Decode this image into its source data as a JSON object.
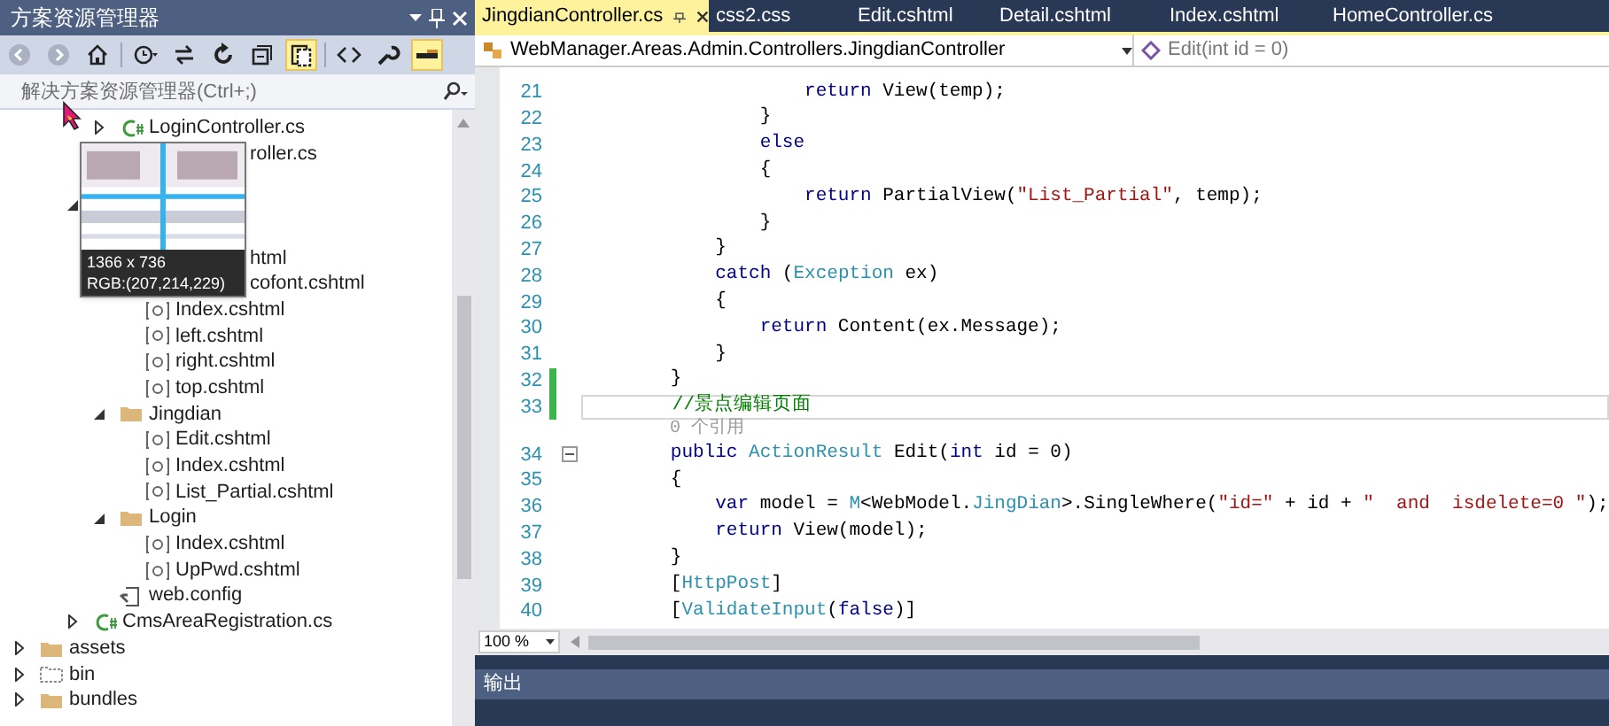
{
  "solution_explorer": {
    "title": "方案资源管理器",
    "title_buttons": [
      {
        "kind": "dropdown"
      },
      {
        "kind": "pin"
      },
      {
        "kind": "close"
      }
    ],
    "toolbar": [
      {
        "kind": "back",
        "active": false
      },
      {
        "kind": "forward",
        "active": false
      },
      {
        "kind": "home",
        "active": false
      },
      {
        "kind": "history",
        "active": false
      },
      {
        "kind": "sync",
        "active": false
      },
      {
        "kind": "refresh",
        "active": false
      },
      {
        "kind": "collapse",
        "active": false
      },
      {
        "kind": "show_all",
        "active": true
      },
      {
        "kind": "code",
        "active": false
      },
      {
        "kind": "wrench",
        "active": false
      },
      {
        "kind": "preview",
        "active": true
      }
    ],
    "search": {
      "placeholder": "解决方案资源管理器(Ctrl+;)"
    },
    "tree": [
      {
        "children": [
          {
            "children": [
              {
                "children": [
                  {
                    "kind": "cs",
                    "label": "LoginController.cs",
                    "expanded": false
                  },
                  {
                    "kind": "fragment",
                    "label": "roller.cs"
                  }
                ]
              },
              {
                "kind": "hidden"
              },
              {
                "kind": "hidden",
                "expanded": true,
                "children": [
                  {
                    "kind": "hidden",
                    "children": [
                      {
                        "kind": "fragment",
                        "label": "html"
                      },
                      {
                        "kind": "fragment",
                        "label": "cofont.cshtml"
                      },
                      {
                        "kind": "cshtml",
                        "label": "Index.cshtml"
                      },
                      {
                        "kind": "cshtml",
                        "label": "left.cshtml"
                      },
                      {
                        "kind": "cshtml",
                        "label": "right.cshtml"
                      },
                      {
                        "kind": "cshtml",
                        "label": "top.cshtml"
                      }
                    ]
                  },
                  {
                    "kind": "folder",
                    "label": "Jingdian",
                    "expanded": true,
                    "children": [
                      {
                        "kind": "cshtml",
                        "label": "Edit.cshtml"
                      },
                      {
                        "kind": "cshtml",
                        "label": "Index.cshtml"
                      },
                      {
                        "kind": "cshtml",
                        "label": "List_Partial.cshtml"
                      }
                    ]
                  },
                  {
                    "kind": "folder",
                    "label": "Login",
                    "expanded": true,
                    "children": [
                      {
                        "kind": "cshtml",
                        "label": "Index.cshtml"
                      },
                      {
                        "kind": "cshtml",
                        "label": "UpPwd.cshtml"
                      }
                    ]
                  },
                  {
                    "kind": "config",
                    "label": "web.config"
                  }
                ]
              },
              {
                "kind": "cs",
                "label": "CmsAreaRegistration.cs",
                "expanded": false
              }
            ]
          }
        ]
      },
      {
        "kind": "folder",
        "label": "assets",
        "expanded": false
      },
      {
        "kind": "dashed_folder",
        "label": "bin",
        "expanded": false
      },
      {
        "kind": "folder",
        "label": "bundles",
        "expanded": false
      }
    ]
  },
  "magnifier": {
    "size": "1366 x 736",
    "rgb_reading": "RGB:(207,214,229)"
  },
  "editor": {
    "tabs": [
      {
        "label": "JingdianController.cs",
        "selected": true
      },
      {
        "label": "css2.css",
        "selected": false
      },
      {
        "label": "Edit.cshtml",
        "selected": false
      },
      {
        "label": "Detail.cshtml",
        "selected": false
      },
      {
        "label": "Index.cshtml",
        "selected": false
      },
      {
        "label": "HomeController.cs",
        "selected": false
      }
    ],
    "class_dropdown": "WebManager.Areas.Admin.Controllers.JingdianController",
    "member_dropdown": "Edit(int id = 0)",
    "lines": [
      {
        "kind": "code",
        "number": "21",
        "tokens": [
          {
            "kind": "keyword",
            "text": "                    return"
          },
          {
            "kind": "plain",
            "text": " View(temp);"
          }
        ]
      },
      {
        "kind": "code",
        "number": "22",
        "tokens": [
          {
            "kind": "plain",
            "text": "                }"
          }
        ]
      },
      {
        "kind": "code",
        "number": "23",
        "tokens": [
          {
            "kind": "keyword",
            "text": "                else"
          }
        ]
      },
      {
        "kind": "code",
        "number": "24",
        "tokens": [
          {
            "kind": "plain",
            "text": "                {"
          }
        ]
      },
      {
        "kind": "code",
        "number": "25",
        "tokens": [
          {
            "kind": "keyword",
            "text": "                    return"
          },
          {
            "kind": "plain",
            "text": " PartialView("
          },
          {
            "kind": "string",
            "text": "\"List_Partial\""
          },
          {
            "kind": "plain",
            "text": ", temp);"
          }
        ]
      },
      {
        "kind": "code",
        "number": "26",
        "tokens": [
          {
            "kind": "plain",
            "text": "                }"
          }
        ]
      },
      {
        "kind": "code",
        "number": "27",
        "tokens": [
          {
            "kind": "plain",
            "text": "            }"
          }
        ]
      },
      {
        "kind": "code",
        "number": "28",
        "tokens": [
          {
            "kind": "keyword",
            "text": "            catch"
          },
          {
            "kind": "plain",
            "text": " ("
          },
          {
            "kind": "type",
            "text": "Exception"
          },
          {
            "kind": "plain",
            "text": " ex)"
          }
        ]
      },
      {
        "kind": "code",
        "number": "29",
        "tokens": [
          {
            "kind": "plain",
            "text": "            {"
          }
        ]
      },
      {
        "kind": "code",
        "number": "30",
        "tokens": [
          {
            "kind": "keyword",
            "text": "                return"
          },
          {
            "kind": "plain",
            "text": " Content(ex.Message);"
          }
        ]
      },
      {
        "kind": "code",
        "number": "31",
        "tokens": [
          {
            "kind": "plain",
            "text": "            }"
          }
        ]
      },
      {
        "kind": "code",
        "number": "32",
        "changed": true,
        "tokens": [
          {
            "kind": "plain",
            "text": "        }"
          }
        ]
      },
      {
        "kind": "code",
        "number": "33",
        "changed": true,
        "current": true,
        "tokens": [
          {
            "kind": "comment",
            "text": "        //景点编辑页面"
          }
        ]
      },
      {
        "kind": "lens",
        "text": "0 个引用"
      },
      {
        "kind": "code",
        "number": "34",
        "foldable": true,
        "tokens": [
          {
            "kind": "keyword",
            "text": "        public"
          },
          {
            "kind": "type",
            "text": " ActionResult"
          },
          {
            "kind": "plain",
            "text": " Edit("
          },
          {
            "kind": "keyword",
            "text": "int"
          },
          {
            "kind": "plain",
            "text": " id = 0)"
          }
        ]
      },
      {
        "kind": "code",
        "number": "35",
        "tokens": [
          {
            "kind": "plain",
            "text": "        {"
          }
        ]
      },
      {
        "kind": "code",
        "number": "36",
        "tokens": [
          {
            "kind": "keyword",
            "text": "            var"
          },
          {
            "kind": "plain",
            "text": " model = "
          },
          {
            "kind": "type",
            "text": "M"
          },
          {
            "kind": "plain",
            "text": "<WebModel."
          },
          {
            "kind": "type",
            "text": "JingDian"
          },
          {
            "kind": "plain",
            "text": ">.SingleWhere("
          },
          {
            "kind": "string",
            "text": "\"id=\""
          },
          {
            "kind": "plain",
            "text": " + id + "
          },
          {
            "kind": "string",
            "text": "\"  and  isdelete=0 \""
          },
          {
            "kind": "plain",
            "text": ");"
          }
        ]
      },
      {
        "kind": "code",
        "number": "37",
        "tokens": [
          {
            "kind": "keyword",
            "text": "            return"
          },
          {
            "kind": "plain",
            "text": " View(model);"
          }
        ]
      },
      {
        "kind": "code",
        "number": "38",
        "tokens": [
          {
            "kind": "plain",
            "text": "        }"
          }
        ]
      },
      {
        "kind": "code",
        "number": "39",
        "tokens": [
          {
            "kind": "plain",
            "text": "        ["
          },
          {
            "kind": "type",
            "text": "HttpPost"
          },
          {
            "kind": "plain",
            "text": "]"
          }
        ]
      },
      {
        "kind": "code",
        "number": "40",
        "tokens": [
          {
            "kind": "plain",
            "text": "        ["
          },
          {
            "kind": "type",
            "text": "ValidateInput"
          },
          {
            "kind": "plain",
            "text": "("
          },
          {
            "kind": "keyword",
            "text": "false"
          },
          {
            "kind": "plain",
            "text": ")]"
          }
        ]
      }
    ],
    "zoom": "100 %"
  },
  "output_panel": {
    "title": "输出"
  }
}
